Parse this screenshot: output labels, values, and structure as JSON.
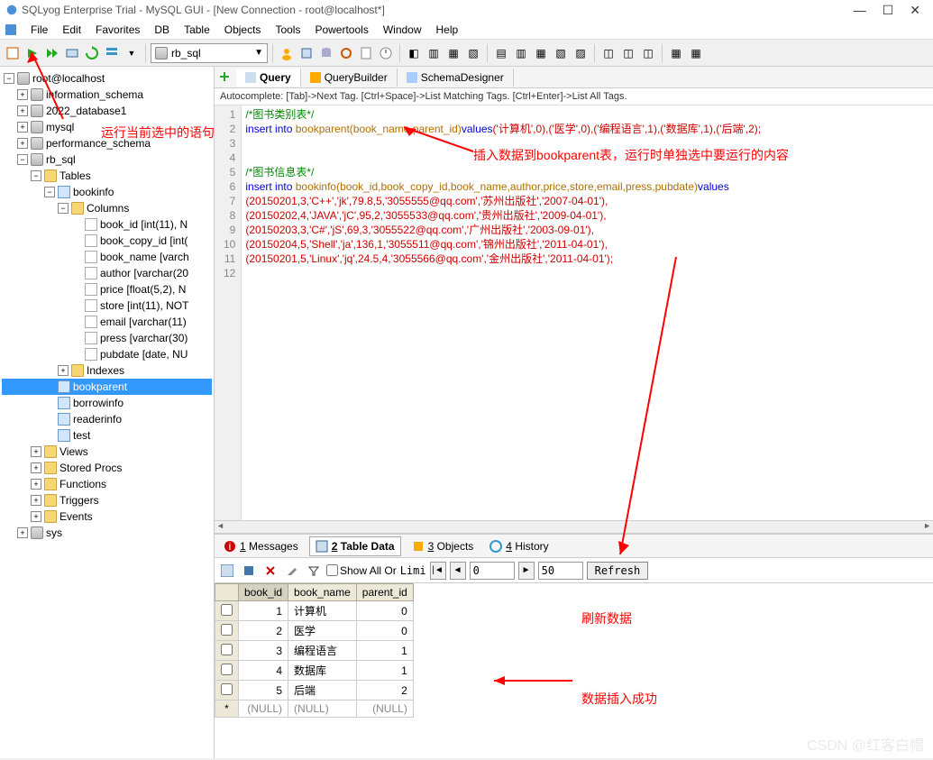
{
  "title": "SQLyog Enterprise Trial - MySQL GUI - [New Connection - root@localhost*]",
  "menu": [
    "File",
    "Edit",
    "Favorites",
    "DB",
    "Table",
    "Objects",
    "Tools",
    "Powertools",
    "Window",
    "Help"
  ],
  "db_selector": "rb_sql",
  "tree": {
    "root": "root@localhost",
    "dbs": [
      {
        "name": "information_schema",
        "expanded": false
      },
      {
        "name": "2022_database1",
        "expanded": false
      },
      {
        "name": "mysql",
        "expanded": false
      },
      {
        "name": "performance_schema",
        "expanded": false
      },
      {
        "name": "rb_sql",
        "expanded": true,
        "children": [
          {
            "name": "Tables",
            "type": "folder",
            "expanded": true,
            "children": [
              {
                "name": "bookinfo",
                "type": "table",
                "expanded": true,
                "children": [
                  {
                    "name": "Columns",
                    "type": "folder",
                    "expanded": true,
                    "children": [
                      {
                        "name": "book_id [int(11), N",
                        "type": "col"
                      },
                      {
                        "name": "book_copy_id [int(",
                        "type": "col"
                      },
                      {
                        "name": "book_name [varch",
                        "type": "col"
                      },
                      {
                        "name": "author [varchar(20",
                        "type": "col"
                      },
                      {
                        "name": "price [float(5,2), N",
                        "type": "col"
                      },
                      {
                        "name": "store [int(11), NOT",
                        "type": "col"
                      },
                      {
                        "name": "email [varchar(11)",
                        "type": "col"
                      },
                      {
                        "name": "press [varchar(30)",
                        "type": "col"
                      },
                      {
                        "name": "pubdate [date, NU",
                        "type": "col"
                      }
                    ]
                  },
                  {
                    "name": "Indexes",
                    "type": "folder",
                    "expanded": false
                  }
                ]
              },
              {
                "name": "bookparent",
                "type": "table",
                "selected": true
              },
              {
                "name": "borrowinfo",
                "type": "table"
              },
              {
                "name": "readerinfo",
                "type": "table"
              },
              {
                "name": "test",
                "type": "table"
              }
            ]
          },
          {
            "name": "Views",
            "type": "folder"
          },
          {
            "name": "Stored Procs",
            "type": "folder"
          },
          {
            "name": "Functions",
            "type": "folder"
          },
          {
            "name": "Triggers",
            "type": "folder"
          },
          {
            "name": "Events",
            "type": "folder"
          }
        ]
      },
      {
        "name": "sys",
        "expanded": false
      }
    ]
  },
  "editor_tabs": [
    {
      "label": "Query",
      "active": true
    },
    {
      "label": "QueryBuilder",
      "active": false
    },
    {
      "label": "SchemaDesigner",
      "active": false
    }
  ],
  "autocomplete_hint": "Autocomplete: [Tab]->Next Tag. [Ctrl+Space]->List Matching Tags. [Ctrl+Enter]->List All Tags.",
  "code_lines": [
    {
      "n": 1,
      "t": "/*图书类别表*/",
      "cls": "c-cmt"
    },
    {
      "n": 2,
      "raw": true
    },
    {
      "n": 3,
      "t": "",
      "cls": ""
    },
    {
      "n": 4,
      "t": "",
      "cls": ""
    },
    {
      "n": 5,
      "t": "/*图书信息表*/",
      "cls": "c-cmt"
    },
    {
      "n": 6,
      "raw6": true
    },
    {
      "n": 7,
      "raw7": true
    },
    {
      "n": 8,
      "raw8": true
    },
    {
      "n": 9,
      "raw9": true
    },
    {
      "n": 10,
      "raw10": true
    },
    {
      "n": 11,
      "raw11": true
    },
    {
      "n": 12,
      "t": "",
      "cls": ""
    }
  ],
  "sql": {
    "l2_insert": "insert into",
    "l2_tbl": " bookparent(book_name,parent_id)",
    "l2_val": "values",
    "l2_data": "('计算机',0),('医学',0),('编程语言',1),('数据库',1),('后端',2);",
    "l6_insert": "insert into",
    "l6_tbl": " bookinfo(book_id,book_copy_id,book_name,author,price,store,email,press,pubdate)",
    "l6_val": "values",
    "l7": "(20150201,3,'C++','jk',79.8,5,'3055555@qq.com','苏州出版社','2007-04-01'),",
    "l8": "(20150202,4,'JAVA','jC',95,2,'3055533@qq.com','贵州出版社','2009-04-01'),",
    "l9": "(20150203,3,'C#','jS',69,3,'3055522@qq.com','广州出版社','2003-09-01'),",
    "l10": "(20150204,5,'Shell','ja',136,1,'3055511@qq.com','锦州出版社','2011-04-01'),",
    "l11": "(20150201,5,'Linux','jq',24.5,4,'3055566@qq.com','金州出版社','2011-04-01');"
  },
  "result_tabs": [
    {
      "label": "1 Messages",
      "u": "1"
    },
    {
      "label": "2 Table Data",
      "u": "2",
      "active": true
    },
    {
      "label": "3 Objects",
      "u": "3"
    },
    {
      "label": "4 History",
      "u": "4"
    }
  ],
  "result_toolbar": {
    "show_all": "Show All Or",
    "limit": "Limi",
    "from": "0",
    "to": "50",
    "refresh": "Refresh"
  },
  "grid": {
    "columns": [
      "book_id",
      "book_name",
      "parent_id"
    ],
    "rows": [
      {
        "book_id": "1",
        "book_name": "计算机",
        "parent_id": "0"
      },
      {
        "book_id": "2",
        "book_name": "医学",
        "parent_id": "0"
      },
      {
        "book_id": "3",
        "book_name": "编程语言",
        "parent_id": "1"
      },
      {
        "book_id": "4",
        "book_name": "数据库",
        "parent_id": "1"
      },
      {
        "book_id": "5",
        "book_name": "后端",
        "parent_id": "2"
      }
    ],
    "null_label": "(NULL)"
  },
  "annotations": {
    "a1": "运行当前选中的语句",
    "a2": "插入数据到bookparent表，运行时单独选中要运行的内容",
    "a3": "刷新数据",
    "a4": "数据插入成功"
  },
  "watermark": "CSDN @红客白帽"
}
